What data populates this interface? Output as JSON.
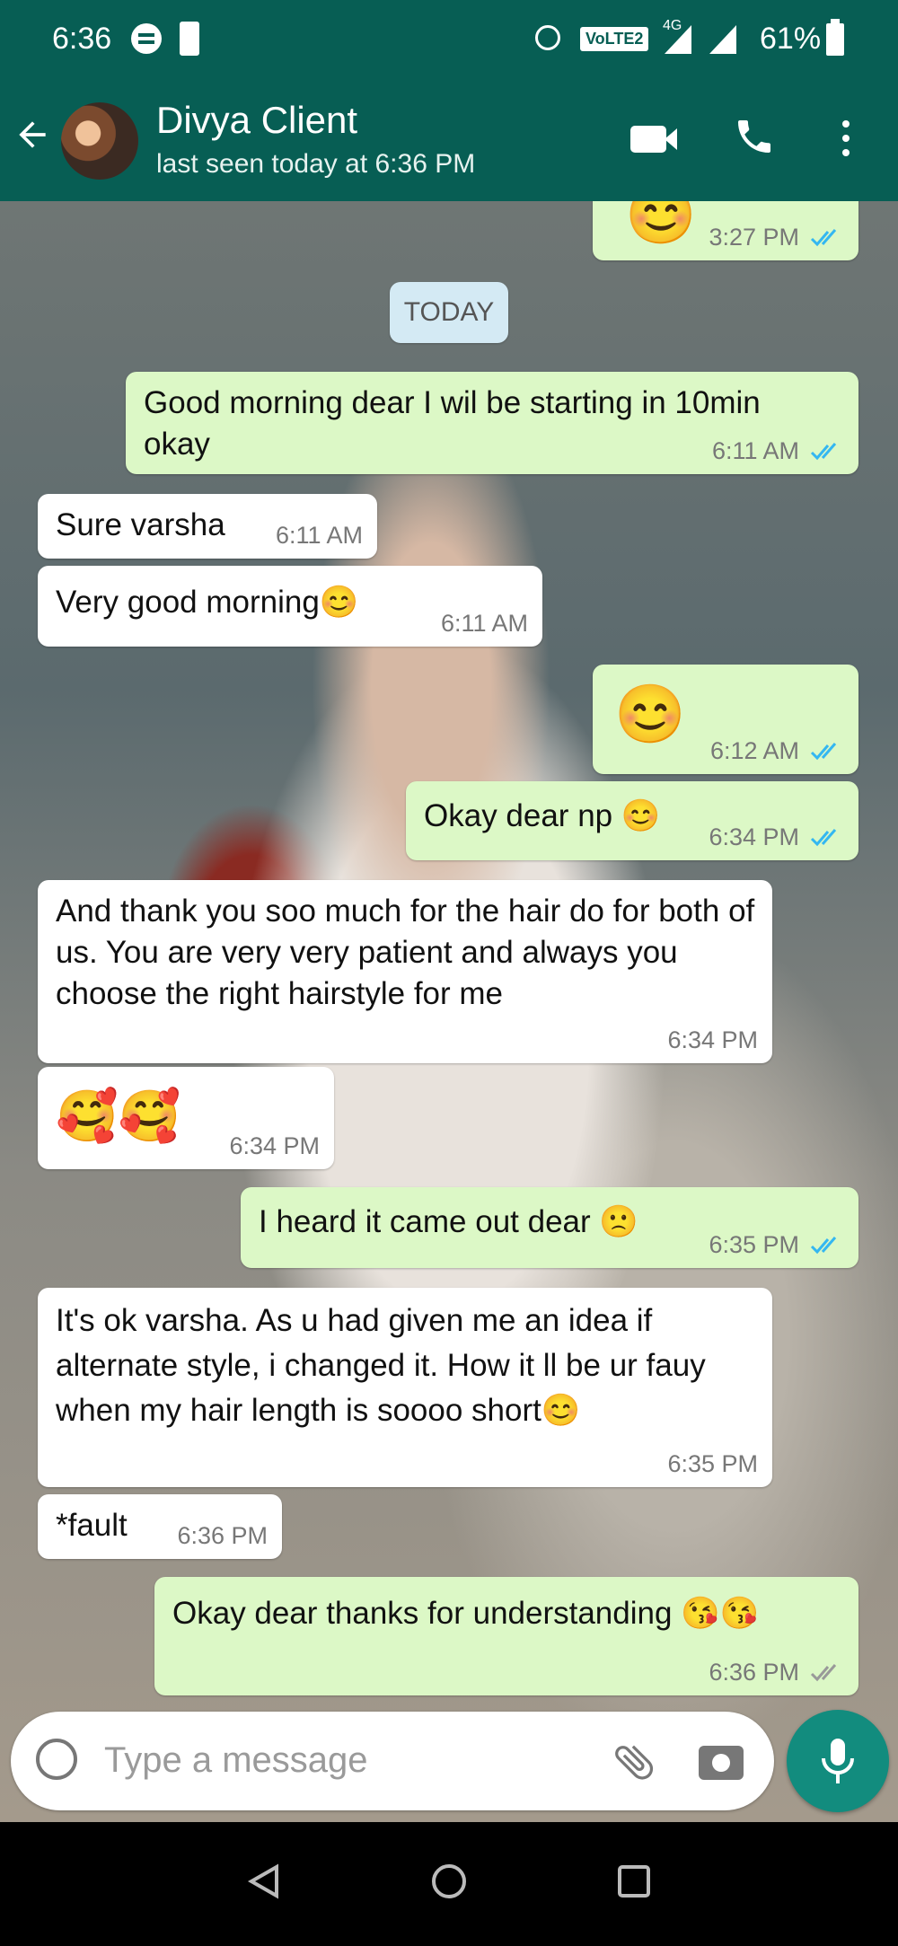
{
  "status_bar": {
    "time": "6:36",
    "volte": "VoLTE2",
    "network": "4G",
    "battery": "61%"
  },
  "header": {
    "contact_name": "Divya Client",
    "last_seen": "last seen today at 6:36 PM"
  },
  "chat": {
    "date_chip": "TODAY",
    "messages": [
      {
        "dir": "out",
        "text": "😊",
        "time": "3:27 PM",
        "status": "read"
      },
      {
        "dir": "out",
        "text": "Good morning dear I wil be starting in 10min okay",
        "time": "6:11 AM",
        "status": "read"
      },
      {
        "dir": "in",
        "text": "Sure varsha",
        "time": "6:11 AM"
      },
      {
        "dir": "in",
        "text": "Very good morning😊",
        "time": "6:11 AM"
      },
      {
        "dir": "out",
        "text": "😊",
        "time": "6:12 AM",
        "status": "read"
      },
      {
        "dir": "out",
        "text": "Okay dear np 😊",
        "time": "6:34 PM",
        "status": "read"
      },
      {
        "dir": "in",
        "text": "And thank you soo much for the hair do for both of us. You are very very patient and always you choose the right hairstyle for me",
        "time": "6:34 PM"
      },
      {
        "dir": "in",
        "text": "🥰🥰",
        "time": "6:34 PM"
      },
      {
        "dir": "out",
        "text": "I heard it came out dear 🙁",
        "time": "6:35 PM",
        "status": "read"
      },
      {
        "dir": "in",
        "text": "It's ok varsha. As u had given me an idea if alternate style, i changed it. How it ll be ur fauy when my hair length is soooo short😊",
        "time": "6:35 PM"
      },
      {
        "dir": "in",
        "text": "*fault",
        "time": "6:36 PM"
      },
      {
        "dir": "out",
        "text": "Okay dear thanks for understanding 😘😘",
        "time": "6:36 PM",
        "status": "delivered"
      }
    ]
  },
  "input": {
    "placeholder": "Type a message"
  },
  "colors": {
    "header": "#075e54",
    "outgoing": "#dcf8c6",
    "incoming": "#ffffff",
    "tick_read": "#34b7f1",
    "mic": "#128c7e"
  },
  "icons": [
    "back-arrow-icon",
    "video-call-icon",
    "phone-icon",
    "more-vert-icon",
    "emoji-icon",
    "attach-icon",
    "camera-icon",
    "mic-icon",
    "nav-back-icon",
    "nav-home-icon",
    "nav-recents-icon"
  ]
}
